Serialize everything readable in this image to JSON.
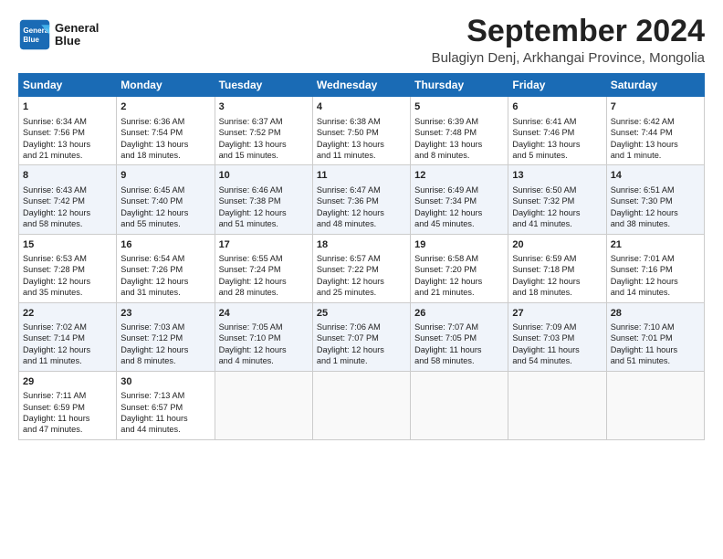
{
  "logo": {
    "line1": "General",
    "line2": "Blue"
  },
  "title": "September 2024",
  "subtitle": "Bulagiyn Denj, Arkhangai Province, Mongolia",
  "days_of_week": [
    "Sunday",
    "Monday",
    "Tuesday",
    "Wednesday",
    "Thursday",
    "Friday",
    "Saturday"
  ],
  "weeks": [
    [
      {
        "day": 1,
        "lines": [
          "Sunrise: 6:34 AM",
          "Sunset: 7:56 PM",
          "Daylight: 13 hours",
          "and 21 minutes."
        ]
      },
      {
        "day": 2,
        "lines": [
          "Sunrise: 6:36 AM",
          "Sunset: 7:54 PM",
          "Daylight: 13 hours",
          "and 18 minutes."
        ]
      },
      {
        "day": 3,
        "lines": [
          "Sunrise: 6:37 AM",
          "Sunset: 7:52 PM",
          "Daylight: 13 hours",
          "and 15 minutes."
        ]
      },
      {
        "day": 4,
        "lines": [
          "Sunrise: 6:38 AM",
          "Sunset: 7:50 PM",
          "Daylight: 13 hours",
          "and 11 minutes."
        ]
      },
      {
        "day": 5,
        "lines": [
          "Sunrise: 6:39 AM",
          "Sunset: 7:48 PM",
          "Daylight: 13 hours",
          "and 8 minutes."
        ]
      },
      {
        "day": 6,
        "lines": [
          "Sunrise: 6:41 AM",
          "Sunset: 7:46 PM",
          "Daylight: 13 hours",
          "and 5 minutes."
        ]
      },
      {
        "day": 7,
        "lines": [
          "Sunrise: 6:42 AM",
          "Sunset: 7:44 PM",
          "Daylight: 13 hours",
          "and 1 minute."
        ]
      }
    ],
    [
      {
        "day": 8,
        "lines": [
          "Sunrise: 6:43 AM",
          "Sunset: 7:42 PM",
          "Daylight: 12 hours",
          "and 58 minutes."
        ]
      },
      {
        "day": 9,
        "lines": [
          "Sunrise: 6:45 AM",
          "Sunset: 7:40 PM",
          "Daylight: 12 hours",
          "and 55 minutes."
        ]
      },
      {
        "day": 10,
        "lines": [
          "Sunrise: 6:46 AM",
          "Sunset: 7:38 PM",
          "Daylight: 12 hours",
          "and 51 minutes."
        ]
      },
      {
        "day": 11,
        "lines": [
          "Sunrise: 6:47 AM",
          "Sunset: 7:36 PM",
          "Daylight: 12 hours",
          "and 48 minutes."
        ]
      },
      {
        "day": 12,
        "lines": [
          "Sunrise: 6:49 AM",
          "Sunset: 7:34 PM",
          "Daylight: 12 hours",
          "and 45 minutes."
        ]
      },
      {
        "day": 13,
        "lines": [
          "Sunrise: 6:50 AM",
          "Sunset: 7:32 PM",
          "Daylight: 12 hours",
          "and 41 minutes."
        ]
      },
      {
        "day": 14,
        "lines": [
          "Sunrise: 6:51 AM",
          "Sunset: 7:30 PM",
          "Daylight: 12 hours",
          "and 38 minutes."
        ]
      }
    ],
    [
      {
        "day": 15,
        "lines": [
          "Sunrise: 6:53 AM",
          "Sunset: 7:28 PM",
          "Daylight: 12 hours",
          "and 35 minutes."
        ]
      },
      {
        "day": 16,
        "lines": [
          "Sunrise: 6:54 AM",
          "Sunset: 7:26 PM",
          "Daylight: 12 hours",
          "and 31 minutes."
        ]
      },
      {
        "day": 17,
        "lines": [
          "Sunrise: 6:55 AM",
          "Sunset: 7:24 PM",
          "Daylight: 12 hours",
          "and 28 minutes."
        ]
      },
      {
        "day": 18,
        "lines": [
          "Sunrise: 6:57 AM",
          "Sunset: 7:22 PM",
          "Daylight: 12 hours",
          "and 25 minutes."
        ]
      },
      {
        "day": 19,
        "lines": [
          "Sunrise: 6:58 AM",
          "Sunset: 7:20 PM",
          "Daylight: 12 hours",
          "and 21 minutes."
        ]
      },
      {
        "day": 20,
        "lines": [
          "Sunrise: 6:59 AM",
          "Sunset: 7:18 PM",
          "Daylight: 12 hours",
          "and 18 minutes."
        ]
      },
      {
        "day": 21,
        "lines": [
          "Sunrise: 7:01 AM",
          "Sunset: 7:16 PM",
          "Daylight: 12 hours",
          "and 14 minutes."
        ]
      }
    ],
    [
      {
        "day": 22,
        "lines": [
          "Sunrise: 7:02 AM",
          "Sunset: 7:14 PM",
          "Daylight: 12 hours",
          "and 11 minutes."
        ]
      },
      {
        "day": 23,
        "lines": [
          "Sunrise: 7:03 AM",
          "Sunset: 7:12 PM",
          "Daylight: 12 hours",
          "and 8 minutes."
        ]
      },
      {
        "day": 24,
        "lines": [
          "Sunrise: 7:05 AM",
          "Sunset: 7:10 PM",
          "Daylight: 12 hours",
          "and 4 minutes."
        ]
      },
      {
        "day": 25,
        "lines": [
          "Sunrise: 7:06 AM",
          "Sunset: 7:07 PM",
          "Daylight: 12 hours",
          "and 1 minute."
        ]
      },
      {
        "day": 26,
        "lines": [
          "Sunrise: 7:07 AM",
          "Sunset: 7:05 PM",
          "Daylight: 11 hours",
          "and 58 minutes."
        ]
      },
      {
        "day": 27,
        "lines": [
          "Sunrise: 7:09 AM",
          "Sunset: 7:03 PM",
          "Daylight: 11 hours",
          "and 54 minutes."
        ]
      },
      {
        "day": 28,
        "lines": [
          "Sunrise: 7:10 AM",
          "Sunset: 7:01 PM",
          "Daylight: 11 hours",
          "and 51 minutes."
        ]
      }
    ],
    [
      {
        "day": 29,
        "lines": [
          "Sunrise: 7:11 AM",
          "Sunset: 6:59 PM",
          "Daylight: 11 hours",
          "and 47 minutes."
        ]
      },
      {
        "day": 30,
        "lines": [
          "Sunrise: 7:13 AM",
          "Sunset: 6:57 PM",
          "Daylight: 11 hours",
          "and 44 minutes."
        ]
      },
      null,
      null,
      null,
      null,
      null
    ]
  ]
}
